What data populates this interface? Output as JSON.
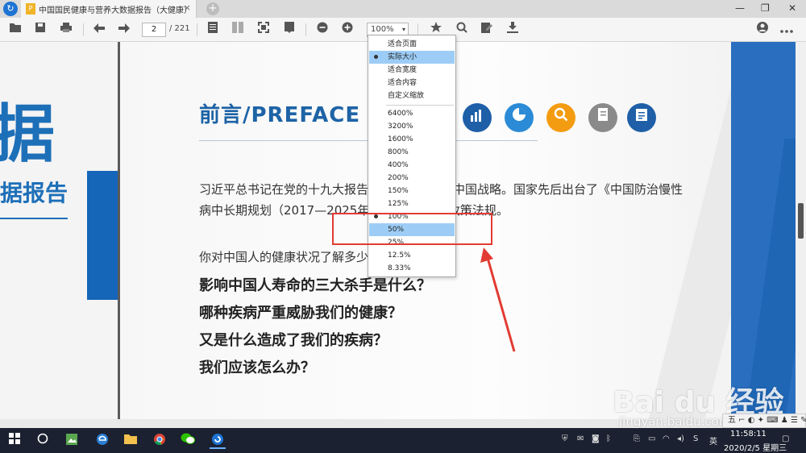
{
  "titlebar": {
    "tab_title": "中国国民健康与营养大数据报告（大健康）",
    "tab_close": "×",
    "new_tab": "+",
    "minimize": "—",
    "restore": "❐",
    "close": "✕"
  },
  "toolbar": {
    "page_current": "2",
    "page_total": "/ 221",
    "zoom_value": "100%",
    "zoom_caret": "▾"
  },
  "zoom_menu": {
    "items": [
      "适合页面",
      "实际大小",
      "适合宽度",
      "适合内容",
      "自定义缩放",
      "6400%",
      "3200%",
      "1600%",
      "800%",
      "400%",
      "200%",
      "150%",
      "125%",
      "100%",
      "50%",
      "25%",
      "12.5%",
      "8.33%"
    ],
    "selected_mode": "实际大小",
    "selected_zoom": "100%",
    "highlighted": "50%"
  },
  "prev_page": {
    "big_text": "据",
    "sub_text": "据报告"
  },
  "page": {
    "title": "前言/PREFACE",
    "paragraph": "习近平总书记在党的十九大报告中提出实施健康中国战略。国家先后出台了《中国防治慢性病中长期规划（2017—2025年）》等多项相关政策法规。",
    "question_plain": "你对中国人的健康状况了解多少？",
    "questions_bold": [
      "影响中国人寿命的三大杀手是什么？",
      "哪种疾病严重威胁我们的健康？",
      "又是什么造成了我们的疾病？",
      "我们应该怎么办？"
    ],
    "icons": [
      {
        "name": "bar-chart-icon",
        "color": "#1f5fa8",
        "glyph": "▥"
      },
      {
        "name": "pie-chart-icon",
        "color": "#2b8bd6",
        "glyph": "◔"
      },
      {
        "name": "magnifier-icon",
        "color": "#f39c12",
        "glyph": "⌕"
      },
      {
        "name": "notebook-icon",
        "color": "#8a8a8a",
        "glyph": "▤"
      },
      {
        "name": "clipboard-icon",
        "color": "#1f5fa8",
        "glyph": "☑"
      }
    ]
  },
  "watermark": {
    "logo": "Bai du 经验",
    "url": "jingyan.baidu.com"
  },
  "ime": {
    "label": "五 ⌐ ◐ ✦ ⌨ ♟ ☰ ✎"
  },
  "taskbar": {
    "time": "11:58:11",
    "date": "2020/2/5 星期三"
  },
  "colors": {
    "brand_blue": "#1d63a6",
    "highlight": "#9dcdf6",
    "annotation_red": "#e23b33"
  }
}
